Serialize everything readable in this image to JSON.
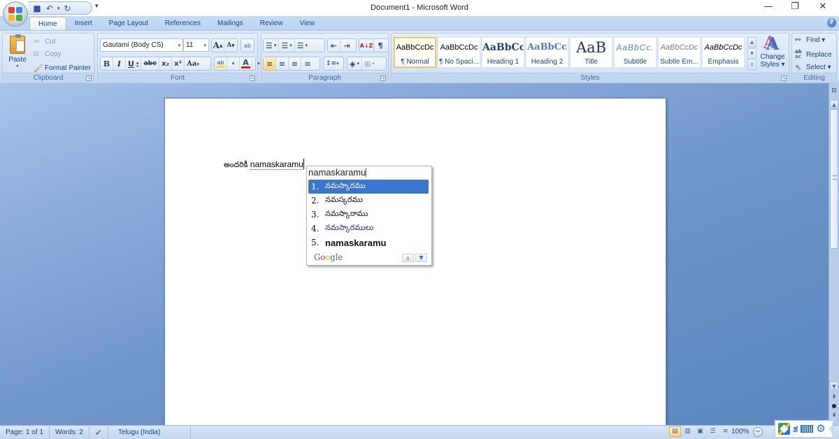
{
  "window": {
    "title": "Document1 - Microsoft Word",
    "controls": {
      "minimize": "—",
      "restore": "❐",
      "close": "✕"
    }
  },
  "quick_access": {
    "items": [
      {
        "name": "save-icon",
        "glyph": "💾"
      },
      {
        "name": "undo-icon",
        "glyph": "↶"
      },
      {
        "name": "redo-icon",
        "glyph": "↻"
      }
    ],
    "more": "▾"
  },
  "tabs": [
    {
      "label": "Home",
      "active": true
    },
    {
      "label": "Insert"
    },
    {
      "label": "Page Layout"
    },
    {
      "label": "References"
    },
    {
      "label": "Mailings"
    },
    {
      "label": "Review"
    },
    {
      "label": "View"
    }
  ],
  "ribbon": {
    "clipboard": {
      "label": "Clipboard",
      "paste": "Paste",
      "cut": "Cut",
      "copy": "Copy",
      "format_painter": "Format Painter"
    },
    "font": {
      "label": "Font",
      "font_name": "Gautami (Body CS)",
      "font_size": "11",
      "grow": "A",
      "shrink": "A",
      "clear": "ab",
      "bold": "B",
      "italic": "I",
      "underline": "U",
      "strikethrough": "abe",
      "subscript": "x₂",
      "superscript": "x²",
      "change_case": "Aa",
      "highlight": "ab",
      "font_color": "A",
      "highlight_color": "#f5e23a",
      "font_color_value": "#d0271d"
    },
    "paragraph": {
      "label": "Paragraph",
      "bullets": "☰",
      "numbering": "☰",
      "multilevel": "☰",
      "decrease_indent": "⇤",
      "increase_indent": "⇥",
      "sort": "A↓Z",
      "show_marks": "¶",
      "align_left": "≡",
      "center": "≡",
      "align_right": "≡",
      "justify": "≡",
      "line_spacing": "↕≡",
      "shading": "◈",
      "borders": "⊞"
    },
    "styles": {
      "label": "Styles",
      "items": [
        {
          "preview": "AaBbCcDc",
          "name": "¶ Normal",
          "selected": true
        },
        {
          "preview": "AaBbCcDc",
          "name": "¶ No Spaci..."
        },
        {
          "preview": "AaBbCc",
          "name": "Heading 1"
        },
        {
          "preview": "AaBbCc",
          "name": "Heading 2"
        },
        {
          "preview": "AaB",
          "name": "Title"
        },
        {
          "preview": "AaBbCc.",
          "name": "Subtitle"
        },
        {
          "preview": "AaBbCcDc",
          "name": "Subtle Em..."
        },
        {
          "preview": "AaBbCcDc",
          "name": "Emphasis"
        }
      ],
      "change_styles_line1": "Change",
      "change_styles_line2": "Styles ▾"
    },
    "editing": {
      "label": "Editing",
      "find": "Find ▾",
      "replace": "Replace",
      "select": "Select ▾"
    }
  },
  "document": {
    "text_telugu": "అందరికీ",
    "text_typed": "namaskaramu"
  },
  "ime_popup": {
    "input": "namaskaramu",
    "suggestions": [
      {
        "num": "1.",
        "word": "నమస్కారము",
        "selected": true
      },
      {
        "num": "2.",
        "word": "నమస్కరము"
      },
      {
        "num": "3.",
        "word": "నమస్కారాము"
      },
      {
        "num": "4.",
        "word": "నమస్కారములు"
      },
      {
        "num": "5.",
        "word": "namaskaramu"
      }
    ],
    "brand": "Google",
    "prev": "▲",
    "next": "▼"
  },
  "status_bar": {
    "page": "Page: 1 of 1",
    "words": "Words: 2",
    "language": "Telugu (India)",
    "zoom": "100%"
  }
}
